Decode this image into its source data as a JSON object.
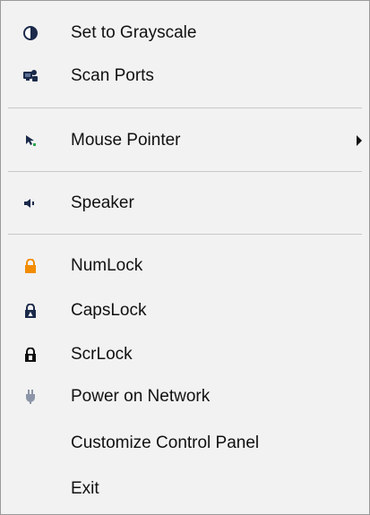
{
  "menu": {
    "items": [
      {
        "label": "Set to Grayscale",
        "icon": "contrast-icon"
      },
      {
        "label": "Scan Ports",
        "icon": "scan-ports-icon"
      },
      {
        "label": "Mouse Pointer",
        "icon": "mouse-pointer-icon",
        "submenu": true
      },
      {
        "label": "Speaker",
        "icon": "speaker-icon"
      },
      {
        "label": "NumLock",
        "icon": "lock-icon",
        "icon_color": "#f28c00"
      },
      {
        "label": "CapsLock",
        "icon": "lock-icon",
        "icon_color": "#1b2a4a"
      },
      {
        "label": "ScrLock",
        "icon": "lock-icon",
        "icon_color": "#111111"
      },
      {
        "label": "Power on Network",
        "icon": "power-plug-icon",
        "icon_color": "#8d96a8"
      },
      {
        "label": "Customize Control Panel",
        "icon": ""
      },
      {
        "label": "Exit",
        "icon": ""
      }
    ]
  }
}
